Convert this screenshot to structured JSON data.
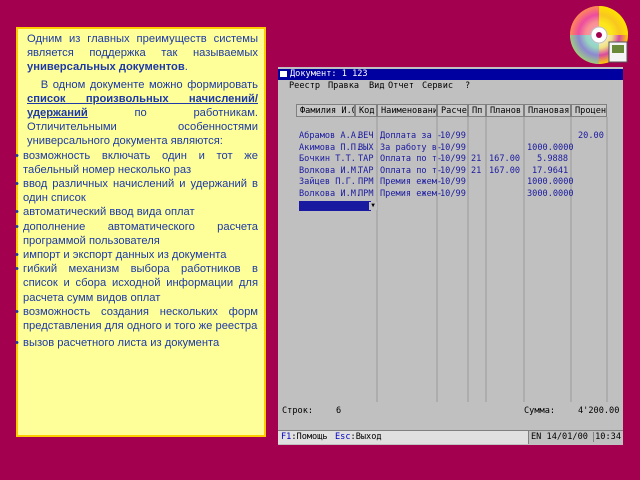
{
  "text_panel": {
    "intro": {
      "p1_before": "Одним из главных преимуществ системы является поддержка так называемых ",
      "p1_bold": "универсальных документов",
      "p1_after": ".",
      "p2_before": "В одном документе можно формировать ",
      "p2_underlined": "список произвольных начислений/удержаний",
      "p2_after": " по работникам. Отличительными особенностями универсального документа являются:"
    },
    "bullets": [
      "возможность включать один и тот же табельный номер несколько раз",
      "ввод различных начислений и удержаний в один список",
      "автоматический ввод вида оплат",
      "дополнение автоматического расчета программой пользователя",
      "импорт и экспорт данных из документа",
      "гибкий механизм выбора работников в список и сбора исходной информации для расчета сумм видов оплат",
      "возможность создания нескольких форм представления для одного и того же реестра",
      "вызов расчетного листа из документа"
    ]
  },
  "dos_window": {
    "title": "Документ: 1 123",
    "menu": [
      "Реестр",
      "Правка",
      "Вид",
      "Отчет",
      "Сервис",
      "?"
    ],
    "columns": [
      "Фамилия И.О.",
      "Код",
      "Наименование",
      "Расче",
      "Пп",
      "Планов",
      "Плановая с",
      "Процен"
    ],
    "rows": [
      {
        "name": "Абрамов А.А.",
        "code": "ВЕЧ",
        "desc": "Доплата за -",
        "calc": "10/99",
        "pp": "",
        "plan": "",
        "plan_sum": "",
        "percent": "20.00"
      },
      {
        "name": "Акимова П.П.",
        "code": "ВЫХ",
        "desc": "За работу в-",
        "calc": "10/99",
        "pp": "",
        "plan": "",
        "plan_sum": "1000.0000",
        "percent": ""
      },
      {
        "name": "Бочкин Т.Т.",
        "code": "ТАР",
        "desc": "Оплата по т-",
        "calc": "10/99",
        "pp": "21",
        "plan": "167.00",
        "plan_sum": "5.9888",
        "percent": ""
      },
      {
        "name": "Волкова И.М.",
        "code": "ТАР",
        "desc": "Оплата по т-",
        "calc": "10/99",
        "pp": "21",
        "plan": "167.00",
        "plan_sum": "17.9641",
        "percent": ""
      },
      {
        "name": "Зайцев П.Г.",
        "code": "ПРМ",
        "desc": "Премия ежем-",
        "calc": "10/99",
        "pp": "",
        "plan": "",
        "plan_sum": "1000.0000",
        "percent": ""
      },
      {
        "name": "Волкова И.М.",
        "code": "ПРМ",
        "desc": "Премия ежем-",
        "calc": "10/99",
        "pp": "",
        "plan": "",
        "plan_sum": "3000.0000",
        "percent": ""
      }
    ],
    "status": {
      "rows_label": "Строк:",
      "rows_value": "6",
      "sum_label": "Сумма:",
      "sum_value": "4'200.00"
    },
    "hints": {
      "f1_key": "F1",
      "f1_label": ":Помощь",
      "esc_key": "Esc",
      "esc_label": ":Выход",
      "lang": "EN",
      "date": "14/01/00",
      "time": "10:34"
    }
  },
  "colors": {
    "background": "#a3004f",
    "panel_bg": "#ffff99",
    "panel_text": "#1d3aa8",
    "dos_title_bg": "#0000a0",
    "dos_row_text": "#1a1aa0"
  },
  "icons": {
    "cd_logo": "cd-disc-logo",
    "system_menu": "system-menu-icon",
    "dropdown": "dropdown-arrow-icon"
  }
}
